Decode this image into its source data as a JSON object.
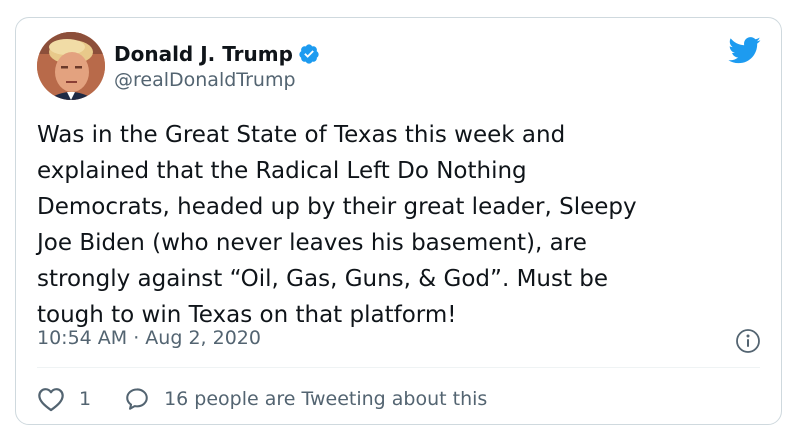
{
  "user": {
    "display_name": "Donald J. Trump",
    "handle": "@realDonaldTrump",
    "verified": true
  },
  "tweet": {
    "text_lines": [
      "Was in the Great State of Texas this week and",
      "explained that the Radical Left Do Nothing",
      "Democrats, headed up by their great leader, Sleepy",
      "Joe Biden (who never leaves his basement), are",
      "strongly against “Oil, Gas, Guns, & God”. Must be",
      "tough to win Texas on that platform!"
    ],
    "timestamp": "10:54 AM · Aug 2, 2020"
  },
  "actions": {
    "like_count": "1",
    "conversation_label": "16 people are Tweeting about this"
  },
  "icons": {
    "brand": "twitter-bird-icon",
    "verified": "verified-badge-icon",
    "info": "info-icon",
    "like": "heart-icon",
    "reply": "speech-bubble-icon"
  },
  "colors": {
    "brand_blue": "#1d9bf0",
    "text_primary": "#0f1419",
    "text_secondary": "#536471",
    "border": "#cfd9de"
  }
}
